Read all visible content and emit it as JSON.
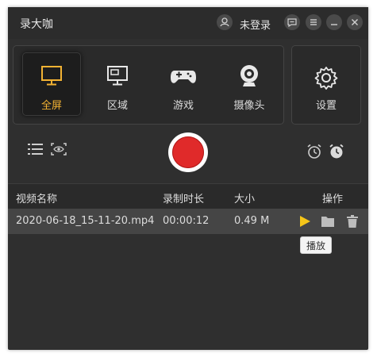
{
  "app": {
    "title": "录大咖"
  },
  "user": {
    "label": "未登录"
  },
  "modes": [
    {
      "label": "全屏",
      "icon": "monitor-icon",
      "active": true
    },
    {
      "label": "区域",
      "icon": "region-icon",
      "active": false
    },
    {
      "label": "游戏",
      "icon": "gamepad-icon",
      "active": false
    },
    {
      "label": "摄像头",
      "icon": "webcam-icon",
      "active": false
    }
  ],
  "settings": {
    "label": "设置"
  },
  "table": {
    "headers": {
      "name": "视频名称",
      "duration": "录制时长",
      "size": "大小",
      "actions": "操作"
    },
    "rows": [
      {
        "name": "2020-06-18_15-11-20.mp4",
        "duration": "00:00:12",
        "size": "0.49 M"
      }
    ]
  },
  "tooltip": {
    "text": "播放"
  },
  "colors": {
    "accent": "#f2b233",
    "record": "#e02a2a",
    "play": "#f5c518"
  }
}
